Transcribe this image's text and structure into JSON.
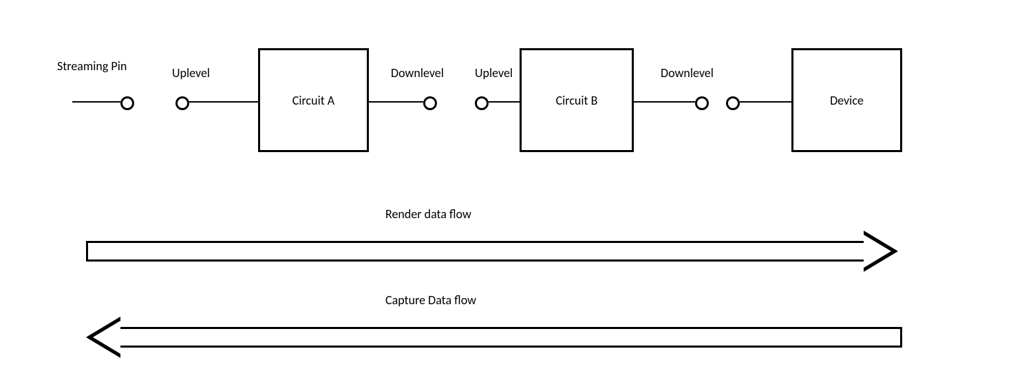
{
  "labels": {
    "streaming_pin": "Streaming Pin",
    "uplevel_1": "Uplevel",
    "downlevel_1": "Downlevel",
    "uplevel_2": "Uplevel",
    "downlevel_2": "Downlevel"
  },
  "boxes": {
    "circuit_a": "Circuit A",
    "circuit_b": "Circuit B",
    "device": "Device"
  },
  "flows": {
    "render": "Render data flow",
    "capture": "Capture Data flow"
  }
}
